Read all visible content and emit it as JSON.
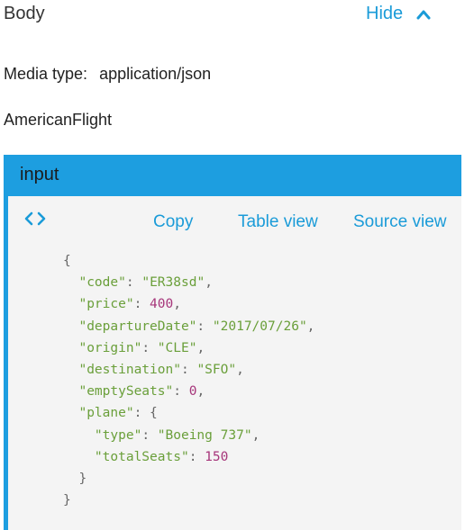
{
  "section": {
    "title": "Body",
    "hide_label": "Hide"
  },
  "media_type": {
    "label": "Media type:",
    "value": "application/json"
  },
  "type_name": "AmericanFlight",
  "panel": {
    "header": "input",
    "actions": {
      "copy": "Copy",
      "table_view": "Table view",
      "source_view": "Source view"
    }
  },
  "code": {
    "code": "ER38sd",
    "price": 400,
    "departureDate": "2017/07/26",
    "origin": "CLE",
    "destination": "SFO",
    "emptySeats": 0,
    "plane": {
      "type": "Boeing 737",
      "totalSeats": 150
    }
  },
  "colors": {
    "accent": "#1d9ee0",
    "link": "#1a9bd8",
    "string": "#6a9f3a",
    "number": "#a6357a"
  },
  "icons": {
    "collapse": "chevron-up-icon",
    "code": "code-brackets-icon"
  }
}
